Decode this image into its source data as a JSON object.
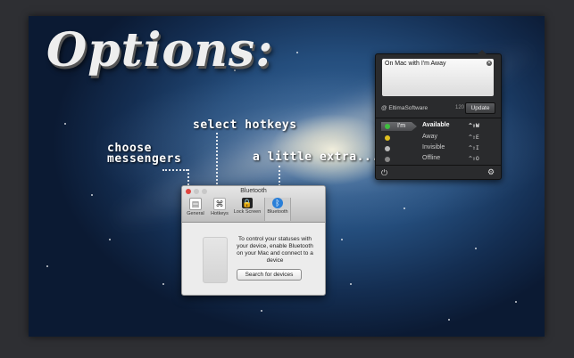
{
  "heading": {
    "title": "Options:",
    "labels": {
      "choose_messengers": [
        "choose",
        "messengers"
      ],
      "select_hotkeys": "select hotkeys",
      "a_little_extra": "a little extra..."
    }
  },
  "menu_panel": {
    "message_text": "On Mac with I'm Away",
    "account": "@ EltimaSoftware",
    "char_count": "120",
    "update_label": "Update",
    "im_label": "I'm",
    "statuses": [
      {
        "label": "Available",
        "hotkey": "^⇧W",
        "color": "#3fbf3f",
        "bold": true
      },
      {
        "label": "Away",
        "hotkey": "^⇧E",
        "color": "#e0c020",
        "bold": false
      },
      {
        "label": "Invisible",
        "hotkey": "^⇧I",
        "color": "#bbbbbb",
        "bold": false
      },
      {
        "label": "Offline",
        "hotkey": "^⇧O",
        "color": "#888888",
        "bold": false
      }
    ],
    "icons": [
      "power-icon",
      "gear-icon"
    ]
  },
  "prefs_window": {
    "title": "Bluetooth",
    "tabs": [
      {
        "label": "General",
        "icon": "general-icon"
      },
      {
        "label": "Hotkeys",
        "icon": "hotkeys-icon"
      },
      {
        "label": "Lock Screen",
        "icon": "lock-screen-icon"
      },
      {
        "label": "Bluetooth",
        "icon": "bluetooth-icon"
      }
    ],
    "description": "To control your statuses with your device, enable Bluetooth on your Mac and connect to a device",
    "search_button": "Search for devices"
  }
}
